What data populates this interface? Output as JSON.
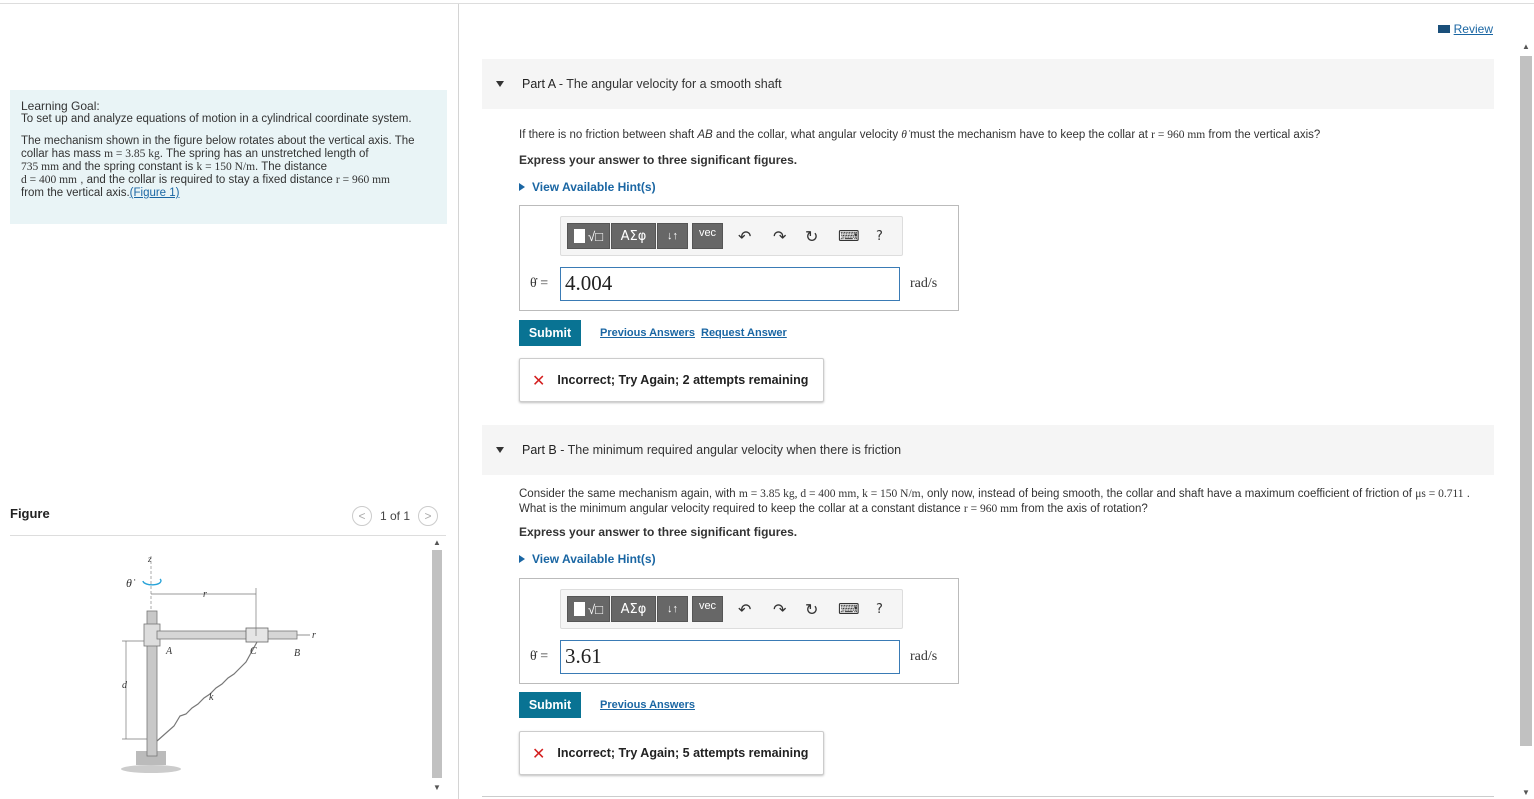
{
  "review": {
    "label": "Review"
  },
  "learning_goal": {
    "title": "Learning Goal:",
    "subtitle": "To set up and analyze equations of motion in a cylindrical coordinate system.",
    "p_start": "The mechanism shown in the figure below rotates about the vertical axis. The collar has mass ",
    "mass": "m = 3.85 kg",
    "p_mid1": ". The spring has an unstretched length of ",
    "length": "735 mm",
    "p_mid2": " and the spring constant is ",
    "spring_k": "k = 150 N/m",
    "p_mid3": ". The distance ",
    "distance_d": "d = 400 mm",
    "p_mid4": " , and the collar is required to stay a fixed distance ",
    "distance_r": "r = 960 mm",
    "p_end": " from the vertical axis.",
    "figure_link": "(Figure 1)"
  },
  "figure": {
    "label": "Figure",
    "pager": "1 of 1",
    "labels": {
      "z": "z",
      "theta_dot": "θ̇",
      "r": "r",
      "A": "A",
      "B": "B",
      "C": "C",
      "d": "d",
      "k": "k",
      "r2": "r"
    }
  },
  "parts": [
    {
      "label": "Part A",
      "title": " - The angular velocity for a smooth shaft",
      "question_1": "If there is no friction between shaft ",
      "question_ab": "AB",
      "question_2": " and the collar, what angular velocity ",
      "question_theta": "θ̇",
      "question_3": "  must the mechanism have to keep the collar at ",
      "question_r": "r = 960 mm",
      "question_4": " from the vertical axis?",
      "express": "Express your answer to three significant figures.",
      "hint": "View Available Hint(s)",
      "toolbar": {
        "templates": "√□",
        "greek": "ΑΣφ",
        "arrows": "↓↑",
        "vec": "vec",
        "undo": "↶",
        "redo": "↷",
        "reset": "↻",
        "keyboard": "⌨",
        "help": "?"
      },
      "var_label": "θ̇ =",
      "answer": "4.004",
      "units": "rad/s",
      "submit": "Submit",
      "prev_answers": "Previous Answers",
      "request_answer": "Request Answer",
      "feedback": "Incorrect; Try Again; 2 attempts remaining"
    },
    {
      "label": "Part B",
      "title": " - The minimum required angular velocity when there is friction",
      "question_1": "Consider the same mechanism again, with ",
      "question_vals": "m = 3.85 kg, d = 400 mm, k = 150 N/m",
      "question_2": ", only now, instead of being smooth, the collar and shaft have a maximum coefficient of friction of ",
      "question_mu": "μs = 0.711",
      "question_3": " . What is the minimum angular velocity required to keep the collar at a constant distance ",
      "question_r": "r = 960 mm",
      "question_4": " from the axis of rotation?",
      "express": "Express your answer to three significant figures.",
      "hint": "View Available Hint(s)",
      "toolbar": {
        "templates": "√□",
        "greek": "ΑΣφ",
        "arrows": "↓↑",
        "vec": "vec",
        "undo": "↶",
        "redo": "↷",
        "reset": "↻",
        "keyboard": "⌨",
        "help": "?"
      },
      "var_label": "θ̇ =",
      "answer": "3.61",
      "units": "rad/s",
      "submit": "Submit",
      "prev_answers": "Previous Answers",
      "feedback": "Incorrect; Try Again; 5 attempts remaining"
    }
  ]
}
